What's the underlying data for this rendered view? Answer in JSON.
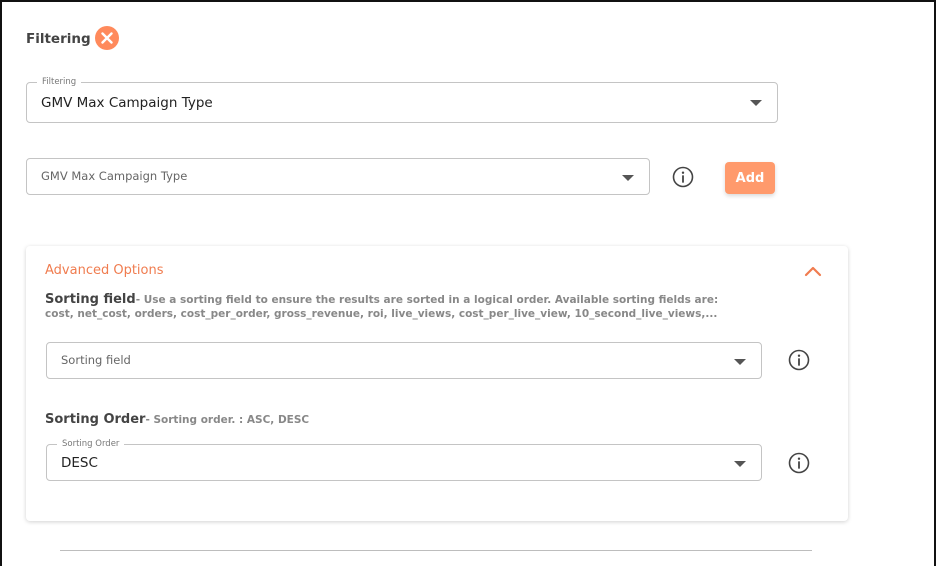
{
  "header": {
    "title": "Filtering",
    "close_icon": "close-x-icon",
    "close_color": "#ff8a5c"
  },
  "filter_select": {
    "label": "Filtering",
    "value": "GMV Max Campaign Type"
  },
  "filter_value_select": {
    "placeholder": "GMV Max Campaign Type"
  },
  "add_button": {
    "label": "Add",
    "color": "#ff9a6c"
  },
  "advanced": {
    "title": "Advanced Options",
    "accent": "#f07c4f",
    "sorting_field": {
      "name": "Sorting field",
      "description": "- Use a sorting field to ensure the results are sorted in a logical order. Available sorting fields are:",
      "description_line2": "cost, net_cost, orders, cost_per_order, gross_revenue, roi, live_views, cost_per_live_view, 10_second_live_views,...",
      "placeholder": "Sorting field"
    },
    "sorting_order": {
      "name": "Sorting Order",
      "description": "- Sorting order. : ASC, DESC",
      "label": "Sorting Order",
      "value": "DESC"
    }
  }
}
